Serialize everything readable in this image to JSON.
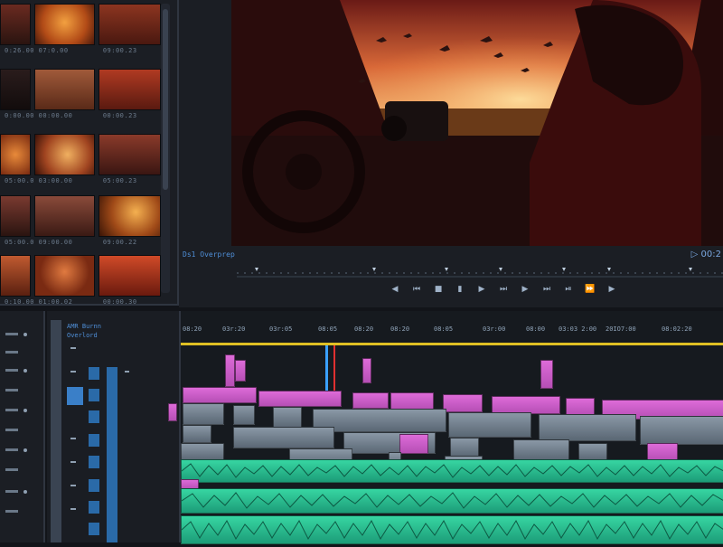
{
  "monitor": {
    "clip_name": "Ds1 Overprep",
    "timecode": "▷ 00:2"
  },
  "track_panel": {
    "title_line1": "AMR Burnn",
    "title_line2": "Overlord"
  },
  "ruler": {
    "ticks": [
      "08:20",
      "03r:20",
      "03r:05",
      "08:05",
      "08:20",
      "08:20",
      "08:05",
      "03r:00",
      "08:00",
      "03:03 2:00",
      "20IO7:00",
      "08:02:20"
    ]
  },
  "media_labels": [
    "0:26.00",
    "07:0.00",
    "09:00.23",
    "0:00.00",
    "00:00.00",
    "00:00.23",
    "05:00.0",
    "03:00.00",
    "05:00.23",
    "05:00.0",
    "09:00.00",
    "09:00.22",
    "0:10.00",
    "01:00.02",
    "00:00.30"
  ]
}
